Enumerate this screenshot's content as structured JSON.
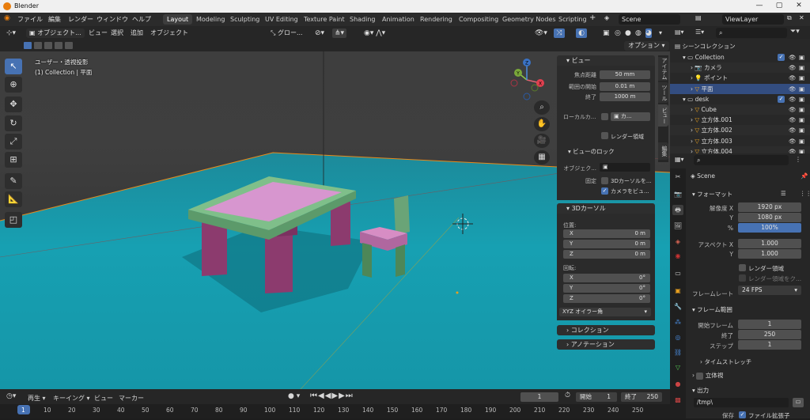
{
  "title": "Blender",
  "menu": [
    "ファイル",
    "編集",
    "レンダー",
    "ウィンドウ",
    "ヘルプ"
  ],
  "workspaces": [
    "Layout",
    "Modeling",
    "Sculpting",
    "UV Editing",
    "Texture Paint",
    "Shading",
    "Animation",
    "Rendering",
    "Compositing",
    "Geometry Nodes",
    "Scripting"
  ],
  "active_workspace": "Layout",
  "scene": "Scene",
  "view_layer": "ViewLayer",
  "viewport_header": {
    "mode": "オブジェクト...",
    "menus": [
      "ビュー",
      "選択",
      "追加",
      "オブジェクト"
    ],
    "orientation": "グロー...",
    "options": "オプション"
  },
  "overlay_text": {
    "view_name": "ユーザー・透視投影",
    "collection": "(1) Collection | 平面"
  },
  "gizmo_axes": {
    "x": "X",
    "y": "Y",
    "z": "Z"
  },
  "npanel": {
    "tabs": [
      "アイテム",
      "ツール",
      "ビュー",
      "編集"
    ],
    "view_header": "ビュー",
    "focal_label": "焦点距離",
    "focal_value": "50 mm",
    "clip_start_label": "範囲の開始",
    "clip_start_value": "0.01 m",
    "clip_end_label": "終了",
    "clip_end_value": "1000 m",
    "local_camera_label": "ローカルカ...",
    "local_camera_value": "カ...",
    "render_region": "レンダー領域",
    "view_lock_header": "ビューのロック",
    "lock_object_label": "オブジェク...",
    "lock_label": "固定",
    "lock_3d_cursor": "3Dカーソルを...",
    "camera_to_view": "カメラをビュ...",
    "cursor_header": "3Dカーソル",
    "location_label": "位置:",
    "loc": [
      {
        "axis": "X",
        "value": "0 m"
      },
      {
        "axis": "Y",
        "value": "0 m"
      },
      {
        "axis": "Z",
        "value": "0 m"
      }
    ],
    "rotation_label": "回転:",
    "rot": [
      {
        "axis": "X",
        "value": "0°"
      },
      {
        "axis": "Y",
        "value": "0°"
      },
      {
        "axis": "Z",
        "value": "0°"
      }
    ],
    "rotation_mode": "XYZ オイラー角",
    "collection_header": "コレクション",
    "annotation_header": "アノテーション"
  },
  "outliner": {
    "root": "シーンコレクション",
    "rows": [
      {
        "name": "Collection",
        "indent": 1
      },
      {
        "name": "カメラ",
        "indent": 2
      },
      {
        "name": "ポイント",
        "indent": 2
      },
      {
        "name": "平面",
        "indent": 2,
        "selected": true
      },
      {
        "name": "desk",
        "indent": 1
      },
      {
        "name": "Cube",
        "indent": 2
      },
      {
        "name": "立方体.001",
        "indent": 2
      },
      {
        "name": "立方体.002",
        "indent": 2
      },
      {
        "name": "立方体.003",
        "indent": 2
      },
      {
        "name": "立方体.004",
        "indent": 2
      }
    ]
  },
  "properties": {
    "scene_name": "Scene",
    "format_header": "フォーマット",
    "res_x_label": "解像度 X",
    "res_x": "1920 px",
    "res_y_label": "Y",
    "res_y": "1080 px",
    "pct_label": "%",
    "pct": "100%",
    "aspect_x_label": "アスペクト X",
    "aspect_x": "1.000",
    "aspect_y_label": "Y",
    "aspect_y": "1.000",
    "render_region": "レンダー領域",
    "crop": "レンダー領域をク...",
    "fps_label": "フレームレート",
    "fps": "24 FPS",
    "frame_range_header": "フレーム範囲",
    "start_label": "開始フレーム",
    "start": "1",
    "end_label": "終了",
    "end": "250",
    "step_label": "ステップ",
    "step": "1",
    "time_stretch": "タイムストレッチ",
    "stereo": "立体視",
    "output_header": "出力",
    "output_path": "/tmp\\",
    "save_label": "保存",
    "file_ext": "ファイル拡張子"
  },
  "timeline": {
    "playback": "再生",
    "keying": "キーイング",
    "view": "ビュー",
    "marker": "マーカー",
    "current_frame": "1",
    "start_label": "開始",
    "start": "1",
    "end_label": "終了",
    "end": "250",
    "ticks": [
      "1",
      "10",
      "20",
      "30",
      "40",
      "50",
      "60",
      "70",
      "80",
      "90",
      "100",
      "110",
      "120",
      "130",
      "140",
      "150",
      "160",
      "170",
      "180",
      "190",
      "200",
      "210",
      "220",
      "230",
      "240",
      "250"
    ]
  }
}
